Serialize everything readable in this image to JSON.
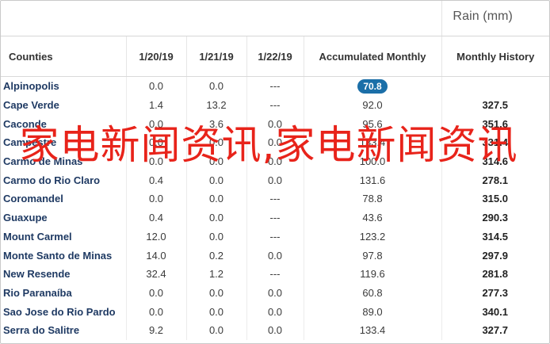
{
  "unit_label": "Rain (mm)",
  "columns": [
    "Counties",
    "1/20/19",
    "1/21/19",
    "1/22/19",
    "Accumulated Monthly",
    "Monthly History"
  ],
  "rows": [
    {
      "county": "Alpinopolis",
      "d1": "0.0",
      "d2": "0.0",
      "d3": "---",
      "acc": "70.8",
      "hist": "",
      "highlight": true
    },
    {
      "county": "Cape Verde",
      "d1": "1.4",
      "d2": "13.2",
      "d3": "---",
      "acc": "92.0",
      "hist": "327.5"
    },
    {
      "county": "Caconde",
      "d1": "0.0",
      "d2": "3.6",
      "d3": "0.0",
      "acc": "95.6",
      "hist": "351.6"
    },
    {
      "county": "Campestre",
      "d1": "0.0",
      "d2": "0.0",
      "d3": "0.0",
      "acc": "133.4",
      "hist": "331.4"
    },
    {
      "county": "Carmo de Minas",
      "d1": "0.0",
      "d2": "0.0",
      "d3": "0.0",
      "acc": "100.0",
      "hist": "314.6"
    },
    {
      "county": "Carmo do Rio Claro",
      "d1": "0.4",
      "d2": "0.0",
      "d3": "0.0",
      "acc": "131.6",
      "hist": "278.1"
    },
    {
      "county": "Coromandel",
      "d1": "0.0",
      "d2": "0.0",
      "d3": "---",
      "acc": "78.8",
      "hist": "315.0"
    },
    {
      "county": "Guaxupe",
      "d1": "0.4",
      "d2": "0.0",
      "d3": "---",
      "acc": "43.6",
      "hist": "290.3"
    },
    {
      "county": "Mount Carmel",
      "d1": "12.0",
      "d2": "0.0",
      "d3": "---",
      "acc": "123.2",
      "hist": "314.5"
    },
    {
      "county": "Monte Santo de Minas",
      "d1": "14.0",
      "d2": "0.2",
      "d3": "0.0",
      "acc": "97.8",
      "hist": "297.9"
    },
    {
      "county": "New Resende",
      "d1": "32.4",
      "d2": "1.2",
      "d3": "---",
      "acc": "119.6",
      "hist": "281.8"
    },
    {
      "county": "Rio Paranaíba",
      "d1": "0.0",
      "d2": "0.0",
      "d3": "0.0",
      "acc": "60.8",
      "hist": "277.3"
    },
    {
      "county": "Sao Jose do Rio Pardo",
      "d1": "0.0",
      "d2": "0.0",
      "d3": "0.0",
      "acc": "89.0",
      "hist": "340.1"
    },
    {
      "county": "Serra do Salitre",
      "d1": "9.2",
      "d2": "0.0",
      "d3": "0.0",
      "acc": "133.4",
      "hist": "327.7"
    }
  ],
  "overlay_text": "家电新闻资讯,家电新闻资讯",
  "colors": {
    "pill": "#1b6fa8",
    "overlay": "#e8231a",
    "county": "#1f3a63"
  }
}
